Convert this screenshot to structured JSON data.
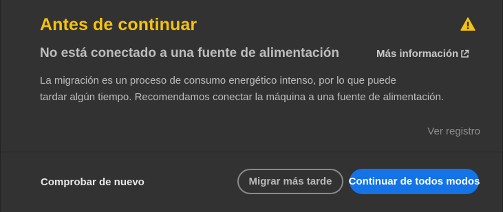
{
  "dialog": {
    "title": "Antes de continuar",
    "icon": "warning-icon",
    "subtitle": "No está conectado a una fuente de alimentación",
    "more_info_label": "Más información",
    "more_info_icon": "external-link-icon",
    "body_lines": [
      "La migración es un proceso de consumo energético intenso, por lo que puede",
      "tardar algún tiempo. Recomendamos conectar la máquina a una fuente de alimentación."
    ],
    "view_log_label": "Ver registro"
  },
  "footer": {
    "check_again_label": "Comprobar de nuevo",
    "migrate_later_label": "Migrar más tarde",
    "continue_label": "Continuar de todos modos"
  },
  "colors": {
    "accent_title": "#f4c20d",
    "primary_button": "#1473e6",
    "background": "#323232"
  }
}
